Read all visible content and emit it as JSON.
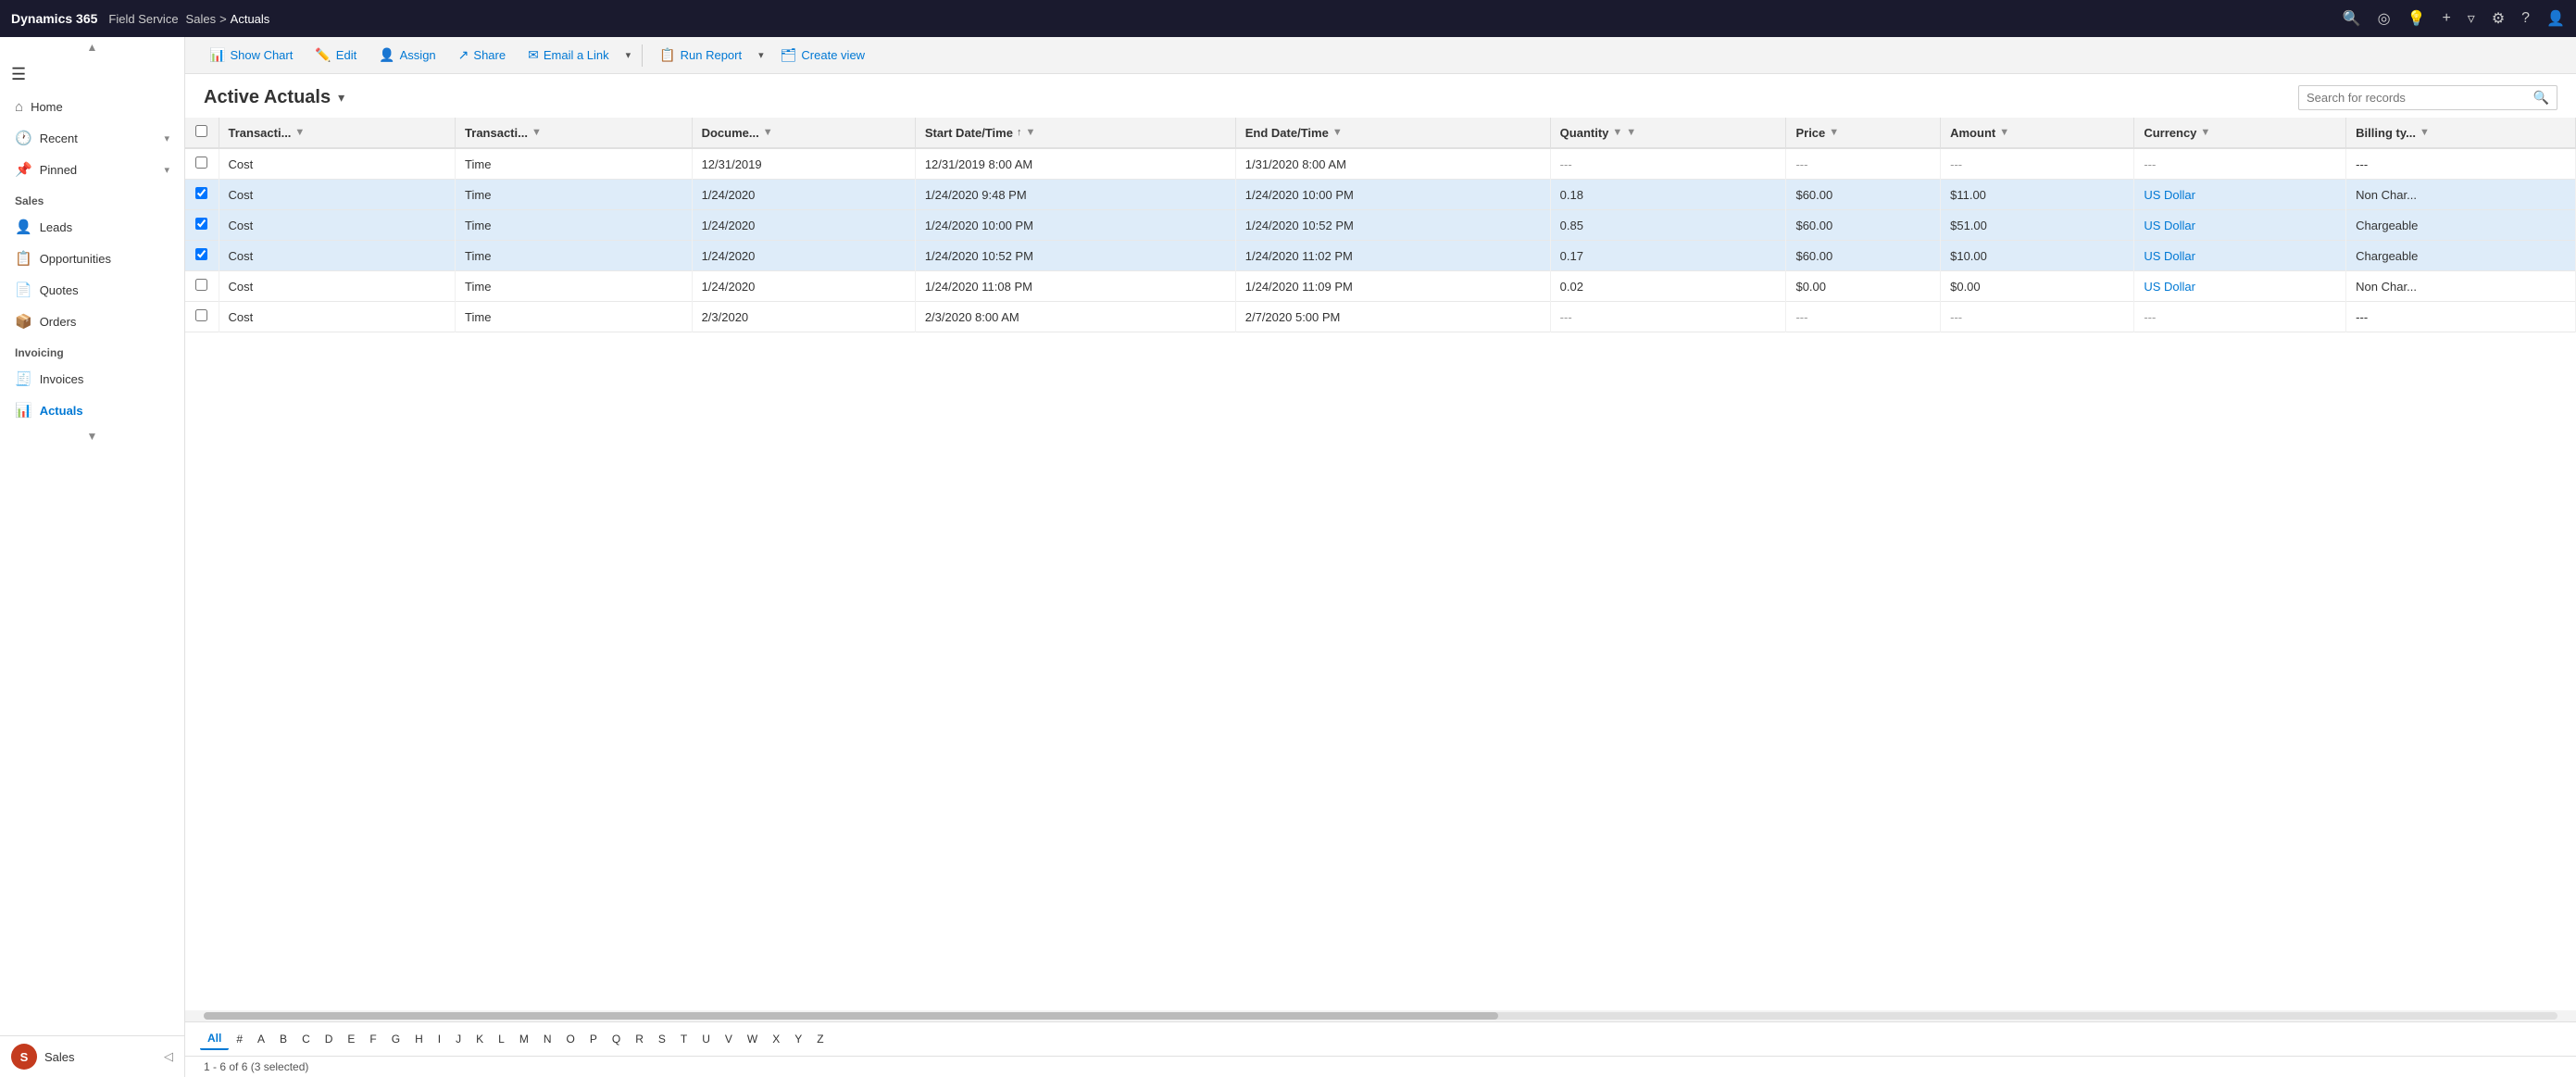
{
  "topnav": {
    "logo": "Dynamics 365",
    "app": "Field Service",
    "breadcrumb": {
      "sales": "Sales",
      "sep": ">",
      "current": "Actuals"
    },
    "icons": [
      "search",
      "target",
      "bulb",
      "plus",
      "filter",
      "gear",
      "help",
      "user"
    ]
  },
  "sidebar": {
    "toggle_icon": "☰",
    "nav_items": [
      {
        "label": "Home",
        "icon": "⌂"
      },
      {
        "label": "Recent",
        "icon": "🕐",
        "chevron": "▾"
      },
      {
        "label": "Pinned",
        "icon": "📌",
        "chevron": "▾"
      }
    ],
    "sections": [
      {
        "title": "Sales",
        "items": [
          {
            "label": "Leads",
            "icon": "👤"
          },
          {
            "label": "Opportunities",
            "icon": "📋"
          },
          {
            "label": "Quotes",
            "icon": "📄"
          },
          {
            "label": "Orders",
            "icon": "📦"
          }
        ]
      },
      {
        "title": "Invoicing",
        "items": [
          {
            "label": "Invoices",
            "icon": "🧾"
          },
          {
            "label": "Actuals",
            "icon": "📊",
            "active": true
          }
        ]
      }
    ],
    "bottom": {
      "avatar_initials": "S",
      "label": "Sales",
      "chevron": "◁"
    }
  },
  "toolbar": {
    "buttons": [
      {
        "id": "show-chart",
        "label": "Show Chart",
        "icon": "📊"
      },
      {
        "id": "edit",
        "label": "Edit",
        "icon": "✏️"
      },
      {
        "id": "assign",
        "label": "Assign",
        "icon": "👤"
      },
      {
        "id": "share",
        "label": "Share",
        "icon": "↗"
      },
      {
        "id": "email-link",
        "label": "Email a Link",
        "icon": "✉"
      },
      {
        "id": "run-report",
        "label": "Run Report",
        "icon": "📋"
      },
      {
        "id": "create-view",
        "label": "Create view",
        "icon": "🗂"
      }
    ]
  },
  "view": {
    "title": "Active Actuals",
    "search_placeholder": "Search for records"
  },
  "table": {
    "columns": [
      {
        "id": "checkbox",
        "label": ""
      },
      {
        "id": "transaction_category",
        "label": "Transacti...",
        "filter": true
      },
      {
        "id": "transaction_type",
        "label": "Transacti...",
        "filter": true
      },
      {
        "id": "document",
        "label": "Docume...",
        "filter": true
      },
      {
        "id": "start_datetime",
        "label": "Start Date/Time",
        "filter": true,
        "sort": "asc"
      },
      {
        "id": "end_datetime",
        "label": "End Date/Time",
        "filter": true
      },
      {
        "id": "quantity",
        "label": "Quantity",
        "filter": true
      },
      {
        "id": "col_extra1",
        "label": "",
        "filter": true
      },
      {
        "id": "price",
        "label": "Price",
        "filter": true
      },
      {
        "id": "amount",
        "label": "Amount",
        "filter": true
      },
      {
        "id": "currency",
        "label": "Currency",
        "filter": true
      },
      {
        "id": "billing_type",
        "label": "Billing ty...",
        "filter": true
      }
    ],
    "rows": [
      {
        "selected": false,
        "transaction_category": "Cost",
        "transaction_type": "Time",
        "document": "12/31/2019",
        "start_datetime": "12/31/2019 8:00 AM",
        "end_datetime": "1/31/2020 8:00 AM",
        "quantity": "---",
        "extra1": "-...",
        "extra2": "-..",
        "price": "---",
        "amount": "---",
        "currency": "---",
        "billing_type": "---"
      },
      {
        "selected": true,
        "transaction_category": "Cost",
        "transaction_type": "Time",
        "document": "1/24/2020",
        "start_datetime": "1/24/2020 9:48 PM",
        "end_datetime": "1/24/2020 10:00 PM",
        "quantity": "0.18",
        "extra1": "-...",
        "extra2": "-..",
        "price": "$60.00",
        "amount": "$11.00",
        "currency": "US Dollar",
        "billing_type": "Non Char..."
      },
      {
        "selected": true,
        "transaction_category": "Cost",
        "transaction_type": "Time",
        "document": "1/24/2020",
        "start_datetime": "1/24/2020 10:00 PM",
        "end_datetime": "1/24/2020 10:52 PM",
        "quantity": "0.85",
        "extra1": "-...",
        "extra2": "-..",
        "price": "$60.00",
        "amount": "$51.00",
        "currency": "US Dollar",
        "billing_type": "Chargeable"
      },
      {
        "selected": true,
        "transaction_category": "Cost",
        "transaction_type": "Time",
        "document": "1/24/2020",
        "start_datetime": "1/24/2020 10:52 PM",
        "end_datetime": "1/24/2020 11:02 PM",
        "quantity": "0.17",
        "extra1": "-...",
        "extra2": "-..",
        "price": "$60.00",
        "amount": "$10.00",
        "currency": "US Dollar",
        "billing_type": "Chargeable"
      },
      {
        "selected": false,
        "transaction_category": "Cost",
        "transaction_type": "Time",
        "document": "1/24/2020",
        "start_datetime": "1/24/2020 11:08 PM",
        "end_datetime": "1/24/2020 11:09 PM",
        "quantity": "0.02",
        "extra1": "-...",
        "extra2": "-..",
        "price": "$0.00",
        "amount": "$0.00",
        "currency": "US Dollar",
        "billing_type": "Non Char..."
      },
      {
        "selected": false,
        "transaction_category": "Cost",
        "transaction_type": "Time",
        "document": "2/3/2020",
        "start_datetime": "2/3/2020 8:00 AM",
        "end_datetime": "2/7/2020 5:00 PM",
        "quantity": "---",
        "extra1": "-...",
        "extra2": "-..",
        "price": "---",
        "amount": "---",
        "currency": "---",
        "billing_type": "---"
      }
    ]
  },
  "pagination": {
    "letters": [
      "All",
      "#",
      "A",
      "B",
      "C",
      "D",
      "E",
      "F",
      "G",
      "H",
      "I",
      "J",
      "K",
      "L",
      "M",
      "N",
      "O",
      "P",
      "Q",
      "R",
      "S",
      "T",
      "U",
      "V",
      "W",
      "X",
      "Y",
      "Z"
    ],
    "active": "All"
  },
  "status": {
    "text": "1 - 6 of 6 (3 selected)"
  }
}
